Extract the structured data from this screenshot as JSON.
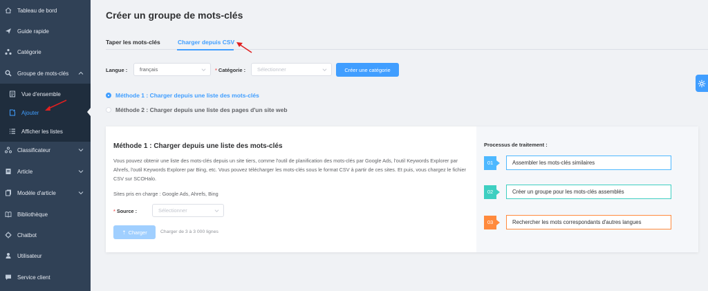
{
  "sidebar": {
    "items": [
      {
        "label": "Tableau de bord",
        "icon": "home-icon"
      },
      {
        "label": "Guide rapide",
        "icon": "send-icon"
      },
      {
        "label": "Catégorie",
        "icon": "category-icon"
      },
      {
        "label": "Groupe de mots-clés",
        "icon": "search-icon"
      },
      {
        "label": "Vue d'ensemble",
        "icon": "document-icon"
      },
      {
        "label": "Ajouter",
        "icon": "add-file-icon"
      },
      {
        "label": "Afficher les listes",
        "icon": "list-icon"
      },
      {
        "label": "Classificateur",
        "icon": "classifier-icon"
      },
      {
        "label": "Article",
        "icon": "article-icon"
      },
      {
        "label": "Modèle d'article",
        "icon": "template-icon"
      },
      {
        "label": "Bibliothèque",
        "icon": "book-icon"
      },
      {
        "label": "Chatbot",
        "icon": "chatbot-icon"
      },
      {
        "label": "Utilisateur",
        "icon": "user-icon"
      },
      {
        "label": "Service client",
        "icon": "chat-icon"
      }
    ]
  },
  "page": {
    "title": "Créer un groupe de mots-clés"
  },
  "tabs": [
    {
      "label": "Taper les mots-clés"
    },
    {
      "label": "Charger depuis CSV"
    }
  ],
  "form": {
    "langue_label": "Langue :",
    "langue_value": "français",
    "categorie_label": "Catégorie :",
    "categorie_placeholder": "Sélectionner",
    "create_category_button": "Créer une catégorie"
  },
  "methods": [
    {
      "label": "Méthode 1 : Charger depuis une liste des mots-clés",
      "selected": true
    },
    {
      "label": "Méthode 2 : Charger depuis une liste des pages d'un site web",
      "selected": false
    }
  ],
  "card": {
    "title": "Méthode 1 : Charger depuis une liste des mots-clés",
    "description": "Vous pouvez obtenir une liste des mots-clés depuis un site tiers, comme l'outil de planification des mots-clés par Google Ads, l'outil Keywords Explorer par Ahrefs, l'outil Keywords Explorer par Bing, etc. Vous pouvez télécharger les mots-clés sous le format CSV à partir de ces sites. Et puis, vous chargez le fichier CSV sur SCOHalo.",
    "sites": "Sites pris en charge : Google Ads, Ahrefs, Bing",
    "source_label": "Source :",
    "source_placeholder": "Sélectionner",
    "upload_button": "Charger",
    "upload_hint": "Charger de 3 à 3 000 lignes"
  },
  "process": {
    "title": "Processus de traitement :",
    "steps": [
      {
        "num": "01",
        "label": "Assembler les mots-clés similaires",
        "color": "#4db8ff"
      },
      {
        "num": "02",
        "label": "Créer un groupe pour les mots-clés assemblés",
        "color": "#3ecfc1"
      },
      {
        "num": "03",
        "label": "Rechercher les mots correspondants d'autres langues",
        "color": "#ff8a3d"
      }
    ]
  },
  "colors": {
    "sidebar_bg": "#304156",
    "accent": "#409eff",
    "annotation_arrow": "#e02020"
  }
}
